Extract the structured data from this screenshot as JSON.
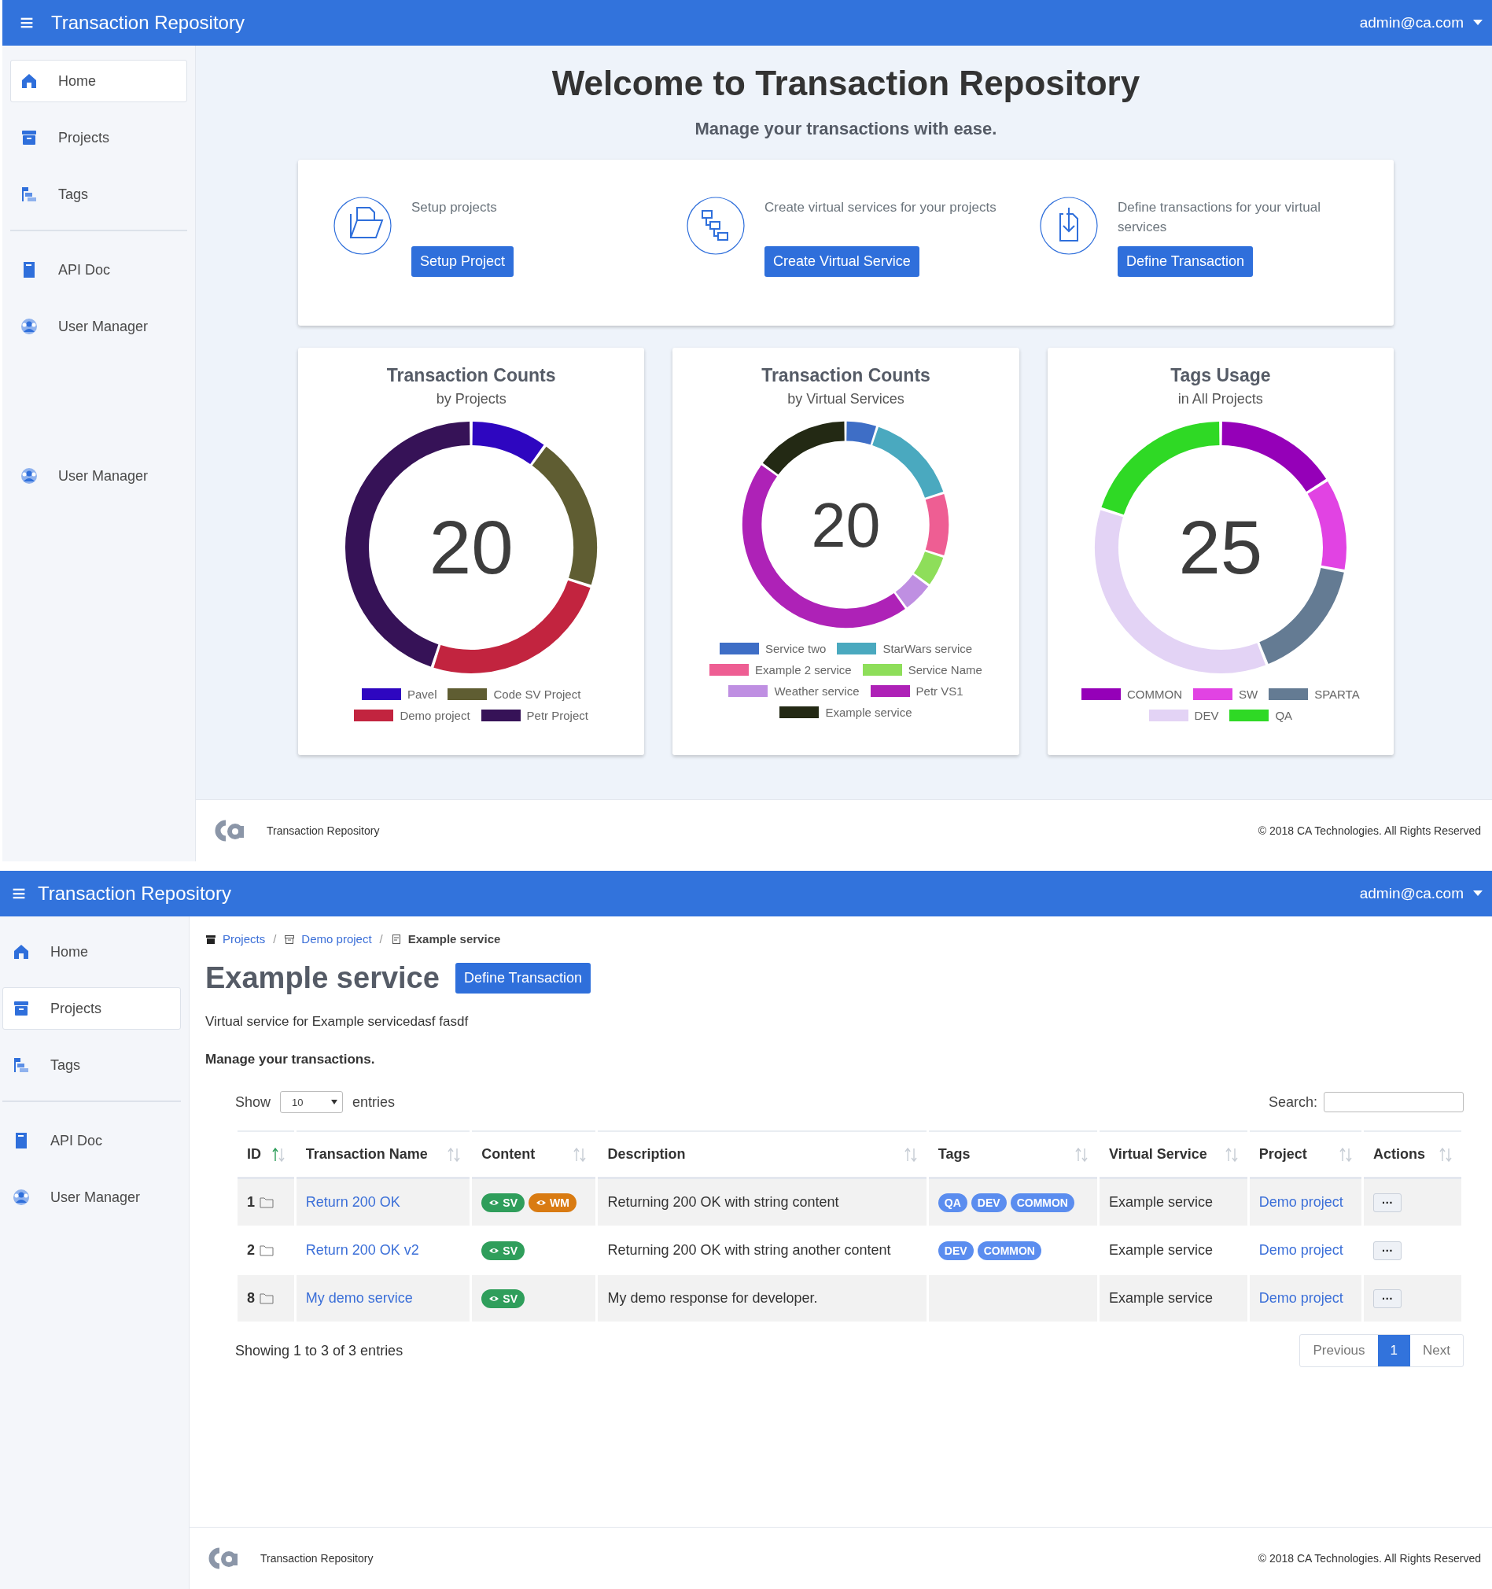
{
  "dashboard_screen": {
    "header": {
      "menu_icon": "≡",
      "title": "Transaction Repository",
      "user": "admin@ca.com"
    },
    "sidebar": {
      "sections": [
        {
          "divider": false,
          "spacer": false,
          "items": [
            {
              "label": "Home",
              "kind": "home",
              "selected": true
            },
            {
              "label": "Projects",
              "kind": "box",
              "selected": false
            },
            {
              "label": "Tags",
              "kind": "tree",
              "selected": false
            }
          ]
        },
        {
          "divider": true,
          "spacer": false,
          "items": [
            {
              "label": "API Doc",
              "kind": "doc",
              "selected": false
            },
            {
              "label": "User Manager",
              "kind": "users",
              "selected": false
            }
          ]
        },
        {
          "divider": false,
          "spacer": true,
          "items": [
            {
              "label": "User Manager",
              "kind": "users",
              "selected": false
            }
          ]
        }
      ]
    },
    "welcome": {
      "title": "Welcome to Transaction Repository",
      "subtitle": "Manage your transactions with ease.",
      "steps": [
        {
          "kind": "folder",
          "text": "Setup projects",
          "button": "Setup Project"
        },
        {
          "kind": "hierarchy",
          "text": "Create virtual services for your projects",
          "button": "Create Virtual Service"
        },
        {
          "kind": "download",
          "text": "Define transactions for your virtual services",
          "button": "Define Transaction"
        }
      ]
    },
    "charts": [
      {
        "title": "Transaction Counts",
        "subtitle": "by Projects",
        "total": "20",
        "legend": [
          {
            "label": "Pavel",
            "color": "#2e06c0"
          },
          {
            "label": "Code SV Project",
            "color": "#5f5d32"
          },
          {
            "label": "Demo project",
            "color": "#c2243f"
          },
          {
            "label": "Petr Project",
            "color": "#361257"
          }
        ]
      },
      {
        "title": "Transaction Counts",
        "subtitle": "by Virtual Services",
        "total": "20",
        "legend": [
          {
            "label": "Service two",
            "color": "#3e6ec6"
          },
          {
            "label": "StarWars service",
            "color": "#4aa9bf"
          },
          {
            "label": "Example 2 service",
            "color": "#ee5e93"
          },
          {
            "label": "Service Name",
            "color": "#8ede5a"
          },
          {
            "label": "Weather service",
            "color": "#bf8fe2"
          },
          {
            "label": "Petr VS1",
            "color": "#ae22b7"
          },
          {
            "label": "Example service",
            "color": "#232914"
          }
        ]
      },
      {
        "title": "Tags Usage",
        "subtitle": "in All Projects",
        "total": "25",
        "legend": [
          {
            "label": "COMMON",
            "color": "#9500b8"
          },
          {
            "label": "SW",
            "color": "#e143e3"
          },
          {
            "label": "SPARTA",
            "color": "#647b93"
          },
          {
            "label": "DEV",
            "color": "#e3d3f5"
          },
          {
            "label": "QA",
            "color": "#2fd925"
          }
        ]
      }
    ],
    "footer": {
      "app": "Transaction Repository",
      "copyright": "© 2018 CA Technologies. All Rights Reserved"
    }
  },
  "service_screen": {
    "header": {
      "menu_icon": "≡",
      "title": "Transaction Repository",
      "user": "admin@ca.com"
    },
    "sidebar": {
      "sections": [
        {
          "divider": false,
          "spacer": false,
          "items": [
            {
              "label": "Home",
              "kind": "home",
              "selected": false
            },
            {
              "label": "Projects",
              "kind": "box",
              "selected": true
            },
            {
              "label": "Tags",
              "kind": "tree",
              "selected": false
            }
          ]
        },
        {
          "divider": true,
          "spacer": false,
          "items": [
            {
              "label": "API Doc",
              "kind": "doc",
              "selected": false
            },
            {
              "label": "User Manager",
              "kind": "users",
              "selected": false
            }
          ]
        }
      ]
    },
    "breadcrumb": {
      "separator": "/",
      "items": [
        {
          "label": "Projects",
          "kind": "box",
          "current": false
        },
        {
          "label": "Demo project",
          "kind": "archive",
          "current": false
        },
        {
          "label": "Example service",
          "kind": "service",
          "current": true
        }
      ]
    },
    "title": "Example service",
    "title_button": "Define Transaction",
    "description": "Virtual service for Example servicedasf fasdf",
    "section_title": "Manage your transactions.",
    "length_menu": {
      "before": "Show",
      "value": "10",
      "after": "entries"
    },
    "search": {
      "label": "Search:"
    },
    "table": {
      "columns": [
        {
          "label": "ID",
          "sorted": true
        },
        {
          "label": "Transaction Name",
          "sorted": false
        },
        {
          "label": "Content",
          "sorted": false
        },
        {
          "label": "Description",
          "sorted": false
        },
        {
          "label": "Tags",
          "sorted": false
        },
        {
          "label": "Virtual Service",
          "sorted": false
        },
        {
          "label": "Project",
          "sorted": false
        },
        {
          "label": "Actions",
          "sorted": false
        }
      ],
      "rows": [
        {
          "id": "1",
          "name": "Return 200 OK",
          "content": [
            {
              "label": "SV",
              "color": "#2f9e5b"
            },
            {
              "label": "WM",
              "color": "#d97b12"
            }
          ],
          "description": "Returning 200 OK with string content",
          "tags": [
            "QA",
            "DEV",
            "COMMON"
          ],
          "virtual_service": "Example service",
          "project": "Demo project",
          "action": "···"
        },
        {
          "id": "2",
          "name": "Return 200 OK v2",
          "content": [
            {
              "label": "SV",
              "color": "#2f9e5b"
            }
          ],
          "description": "Returning 200 OK with string another content",
          "tags": [
            "DEV",
            "COMMON"
          ],
          "virtual_service": "Example service",
          "project": "Demo project",
          "action": "···"
        },
        {
          "id": "8",
          "name": "My demo service",
          "content": [
            {
              "label": "SV",
              "color": "#2f9e5b"
            }
          ],
          "description": "My demo response for developer.",
          "virtual_service": "Example service",
          "project": "Demo project",
          "action": "···"
        }
      ]
    },
    "info": "Showing 1 to 3 of 3 entries",
    "pagination": [
      {
        "label": "Previous",
        "selected": false,
        "disabled": true
      },
      {
        "label": "1",
        "selected": true,
        "disabled": false
      },
      {
        "label": "Next",
        "selected": false,
        "disabled": true
      }
    ],
    "footer": {
      "app": "Transaction Repository",
      "copyright": "© 2018 CA Technologies. All Rights Reserved"
    }
  }
}
